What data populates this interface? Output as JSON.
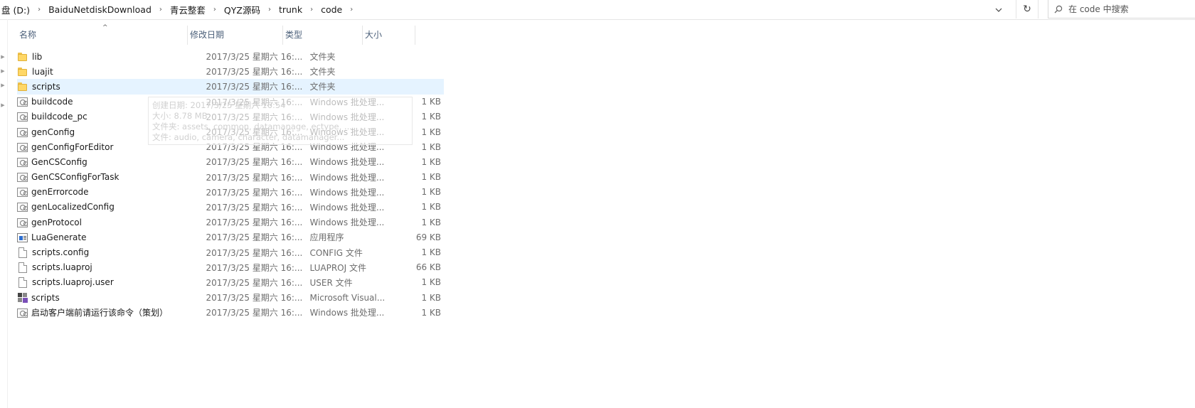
{
  "address": {
    "crumbs": [
      "盘 (D:)",
      "BaiduNetdiskDownload",
      "青云整套",
      "QYZ源码",
      "trunk",
      "code"
    ]
  },
  "search": {
    "placeholder": "在 code 中搜索"
  },
  "columns": {
    "name": "名称",
    "date": "修改日期",
    "type": "类型",
    "size": "大小"
  },
  "files": [
    {
      "name": "lib",
      "date": "2017/3/25 星期六 16:...",
      "type": "文件夹",
      "size": "",
      "icon": "folder-icon"
    },
    {
      "name": "luajit",
      "date": "2017/3/25 星期六 16:...",
      "type": "文件夹",
      "size": "",
      "icon": "folder-icon"
    },
    {
      "name": "scripts",
      "date": "2017/3/25 星期六 16:...",
      "type": "文件夹",
      "size": "",
      "icon": "folder-icon",
      "selected": true
    },
    {
      "name": "buildcode",
      "date": "2017/3/25 星期六 16:...",
      "type": "Windows 批处理...",
      "size": "1 KB",
      "icon": "batch-file-icon"
    },
    {
      "name": "buildcode_pc",
      "date": "2017/3/25 星期六 16:...",
      "type": "Windows 批处理...",
      "size": "1 KB",
      "icon": "batch-file-icon"
    },
    {
      "name": "genConfig",
      "date": "2017/3/25 星期六 16:...",
      "type": "Windows 批处理...",
      "size": "1 KB",
      "icon": "batch-file-icon"
    },
    {
      "name": "genConfigForEditor",
      "date": "2017/3/25 星期六 16:...",
      "type": "Windows 批处理...",
      "size": "1 KB",
      "icon": "batch-file-icon"
    },
    {
      "name": "GenCSConfig",
      "date": "2017/3/25 星期六 16:...",
      "type": "Windows 批处理...",
      "size": "1 KB",
      "icon": "batch-file-icon"
    },
    {
      "name": "GenCSConfigForTask",
      "date": "2017/3/25 星期六 16:...",
      "type": "Windows 批处理...",
      "size": "1 KB",
      "icon": "batch-file-icon"
    },
    {
      "name": "genErrorcode",
      "date": "2017/3/25 星期六 16:...",
      "type": "Windows 批处理...",
      "size": "1 KB",
      "icon": "batch-file-icon"
    },
    {
      "name": "genLocalizedConfig",
      "date": "2017/3/25 星期六 16:...",
      "type": "Windows 批处理...",
      "size": "1 KB",
      "icon": "batch-file-icon"
    },
    {
      "name": "genProtocol",
      "date": "2017/3/25 星期六 16:...",
      "type": "Windows 批处理...",
      "size": "1 KB",
      "icon": "batch-file-icon"
    },
    {
      "name": "LuaGenerate",
      "date": "2017/3/25 星期六 16:...",
      "type": "应用程序",
      "size": "69 KB",
      "icon": "application-icon"
    },
    {
      "name": "scripts.config",
      "date": "2017/3/25 星期六 16:...",
      "type": "CONFIG 文件",
      "size": "1 KB",
      "icon": "file-icon"
    },
    {
      "name": "scripts.luaproj",
      "date": "2017/3/25 星期六 16:...",
      "type": "LUAPROJ 文件",
      "size": "66 KB",
      "icon": "file-icon"
    },
    {
      "name": "scripts.luaproj.user",
      "date": "2017/3/25 星期六 16:...",
      "type": "USER 文件",
      "size": "1 KB",
      "icon": "file-icon"
    },
    {
      "name": "scripts",
      "date": "2017/3/25 星期六 16:...",
      "type": "Microsoft Visual...",
      "size": "1 KB",
      "icon": "visual-studio-solution-icon"
    },
    {
      "name": "启动客户端前请运行该命令（策划）",
      "date": "2017/3/25 星期六 16:...",
      "type": "Windows 批处理...",
      "size": "1 KB",
      "icon": "batch-file-icon"
    }
  ],
  "tooltip": {
    "lines": [
      "创建日期: 2017/3/25 星期六 16:54",
      "大小: 8.78 MB",
      "文件夹: assets, common, datamanage, ectype, ...",
      "文件: audio, camera, character, datamanager..."
    ]
  }
}
